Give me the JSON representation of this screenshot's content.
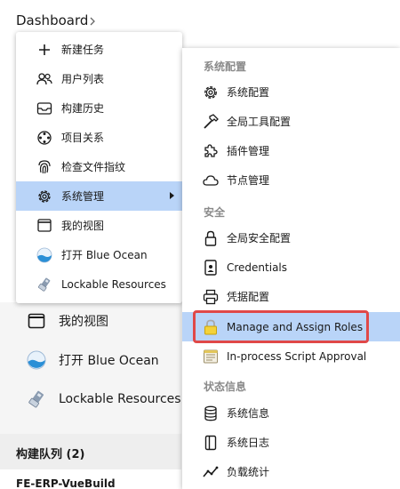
{
  "breadcrumb": {
    "label": "Dashboard"
  },
  "colors": {
    "highlight": "#b9d4f8",
    "annotation": "#e04848",
    "section": "#8a8a8a"
  },
  "background": {
    "items": [
      {
        "label": "我的视图",
        "icon": "window-icon"
      },
      {
        "label": "打开 Blue Ocean",
        "icon": "blue-ocean-icon"
      },
      {
        "label": "Lockable Resources",
        "icon": "usb-icon"
      }
    ],
    "queue_title": "构建队列 (2)",
    "queue_item": "FE-ERP-VueBuild"
  },
  "main_menu": {
    "items": [
      {
        "label": "新建任务",
        "icon": "plus-icon"
      },
      {
        "label": "用户列表",
        "icon": "users-icon"
      },
      {
        "label": "构建历史",
        "icon": "history-icon"
      },
      {
        "label": "项目关系",
        "icon": "relation-icon"
      },
      {
        "label": "检查文件指纹",
        "icon": "fingerprint-icon"
      },
      {
        "label": "系统管理",
        "icon": "gear-icon",
        "active": true
      },
      {
        "label": "我的视图",
        "icon": "window-icon"
      },
      {
        "label": "打开 Blue Ocean",
        "icon": "blue-ocean-icon"
      },
      {
        "label": "Lockable Resources",
        "icon": "usb-icon"
      }
    ]
  },
  "submenu": {
    "sections": {
      "system": "系统配置",
      "security": "安全",
      "status": "状态信息"
    },
    "items": [
      {
        "label": "系统配置",
        "icon": "gear-icon"
      },
      {
        "label": "全局工具配置",
        "icon": "hammer-icon"
      },
      {
        "label": "插件管理",
        "icon": "puzzle-icon"
      },
      {
        "label": "节点管理",
        "icon": "cloud-icon"
      },
      {
        "label": "全局安全配置",
        "icon": "lock-icon"
      },
      {
        "label": "Credentials",
        "icon": "credentials-icon"
      },
      {
        "label": "凭据配置",
        "icon": "printer-icon"
      },
      {
        "label": "Manage and Assign Roles",
        "icon": "padlock-yellow-icon",
        "highlighted": true
      },
      {
        "label": "In-process Script Approval",
        "icon": "notepad-icon"
      },
      {
        "label": "系统信息",
        "icon": "database-icon"
      },
      {
        "label": "系统日志",
        "icon": "log-icon"
      },
      {
        "label": "负载统计",
        "icon": "chart-icon"
      }
    ]
  }
}
